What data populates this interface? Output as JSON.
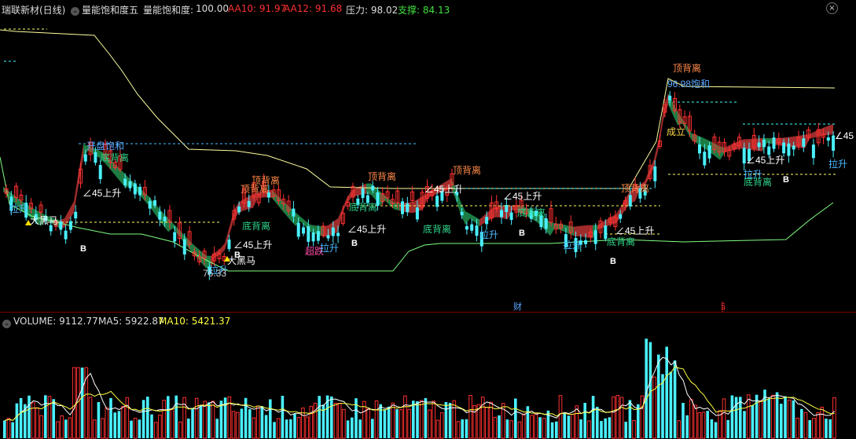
{
  "top_bar": {
    "title": "瑞联新材(日线)",
    "indicator": "量能饱和度五",
    "metric_label": "量能饱和度:",
    "metric_value": "100.00",
    "aa10": "AA10: 91.97",
    "aa12": "AA12: 91.68",
    "pressure": "压力: 98.02",
    "support": "支撑: 84.13",
    "close_icon": "close-icon"
  },
  "annotations": [
    {
      "text": "开盘饱和",
      "color": "#5aa8ff"
    },
    {
      "text": "底背离",
      "color": "#2ed58a"
    },
    {
      "text": "∠45上升",
      "color": "#ffffff"
    },
    {
      "text": "大黑马",
      "color": "#ffffff"
    },
    {
      "text": "拉升",
      "color": "#4ab8ff"
    },
    {
      "text": "B",
      "color": "#ffffff"
    },
    {
      "text": "顶背离",
      "color": "#ff8a4a"
    },
    {
      "text": "底背离",
      "color": "#2ed58a"
    },
    {
      "text": "∠45上升",
      "color": "#ffffff"
    },
    {
      "text": "大黑马",
      "color": "#ffffff"
    },
    {
      "text": "拉升",
      "color": "#4ab8ff"
    },
    {
      "text": "76.33",
      "color": "#cccccc"
    },
    {
      "text": "B",
      "color": "#ffffff"
    },
    {
      "text": "顶背离",
      "color": "#ff8a4a"
    },
    {
      "text": "底背离",
      "color": "#2ed58a"
    },
    {
      "text": "超跌",
      "color": "#ff4aa8"
    },
    {
      "text": "拉升",
      "color": "#4ab8ff"
    },
    {
      "text": "∠45上升",
      "color": "#ffffff"
    },
    {
      "text": "B",
      "color": "#ffffff"
    },
    {
      "text": "顶背离",
      "color": "#ff8a4a"
    },
    {
      "text": "∠45上升",
      "color": "#ffffff"
    },
    {
      "text": "底背离",
      "color": "#2ed58a"
    },
    {
      "text": "顶背离",
      "color": "#ff8a4a"
    },
    {
      "text": "拉升",
      "color": "#4ab8ff"
    },
    {
      "text": "∠45上升",
      "color": "#ffffff"
    },
    {
      "text": "底背离",
      "color": "#2ed58a"
    },
    {
      "text": "B",
      "color": "#ffffff"
    },
    {
      "text": "拉升",
      "color": "#4ab8ff"
    },
    {
      "text": "顶背离",
      "color": "#ff8a4a"
    },
    {
      "text": "∠45上升",
      "color": "#ffffff"
    },
    {
      "text": "底背离",
      "color": "#2ed58a"
    },
    {
      "text": "B",
      "color": "#ffffff"
    },
    {
      "text": "顶背离",
      "color": "#ff8a4a"
    },
    {
      "text": "96.98饱和",
      "color": "#5aa8ff"
    },
    {
      "text": "成立",
      "color": "#ffd84a"
    },
    {
      "text": "∠45上升",
      "color": "#ffffff"
    },
    {
      "text": "拉升",
      "color": "#4ab8ff"
    },
    {
      "text": "底背离",
      "color": "#2ed58a"
    },
    {
      "text": "B",
      "color": "#ffffff"
    },
    {
      "text": "∠45",
      "color": "#ffffff"
    },
    {
      "text": "拉升",
      "color": "#4ab8ff"
    }
  ],
  "time_markers": [
    {
      "text": "财",
      "color": "#5aa8ff"
    },
    {
      "text": "§",
      "color": "#ff3030"
    }
  ],
  "volume_bar": {
    "volume": "VOLUME: 9112.77",
    "ma5": "MA5: 5922.87",
    "ma10": "MA10: 5421.37"
  },
  "chart_data": [
    {
      "type": "candlestick",
      "title": "量能饱和度五",
      "series": [
        {
          "name": "量能饱和度",
          "value": 100.0
        },
        {
          "name": "AA10",
          "value": 91.97
        },
        {
          "name": "AA12",
          "value": 91.68
        },
        {
          "name": "压力",
          "value": 98.02
        },
        {
          "name": "支撑",
          "value": 84.13
        }
      ],
      "price_low_label": 76.33,
      "price_high_label": 96.98,
      "colors": {
        "up": "#ff3030",
        "down": "#4af0ff",
        "pressure_line": "#ffffa0",
        "support_line": "#80ff80",
        "ribbon_up": "#b03030",
        "ribbon_down": "#1f8a4a"
      }
    },
    {
      "type": "bar",
      "title": "VOLUME",
      "series": [
        {
          "name": "VOLUME",
          "value": 9112.77
        },
        {
          "name": "MA5",
          "value": 5922.87
        },
        {
          "name": "MA10",
          "value": 5421.37
        }
      ],
      "colors": {
        "up": "#ff3030",
        "down": "#4af0ff",
        "ma5": "#ffffff",
        "ma10": "#ffff40"
      }
    }
  ]
}
